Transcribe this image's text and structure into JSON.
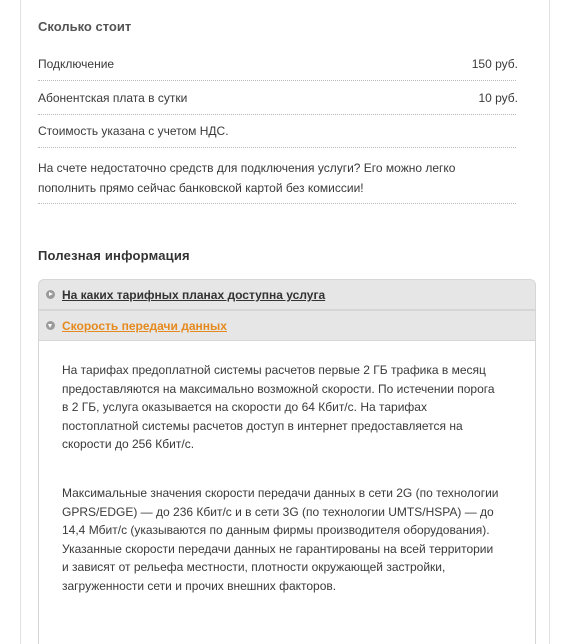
{
  "cost": {
    "title": "Сколько стоит",
    "rows": [
      {
        "label": "Подключение",
        "price": "150 руб."
      },
      {
        "label": "Абонентская плата в сутки",
        "price": "10 руб."
      }
    ],
    "vat_note": "Стоимость указана с учетом НДС.",
    "topup_note": "На счете недостаточно средств для подключения услуги? Его можно легко пополнить прямо сейчас банковской картой без комиссии!"
  },
  "useful": {
    "title": "Полезная информация",
    "items": [
      {
        "label": "На каких тарифных планах доступна услуга"
      },
      {
        "label": "Скорость передачи данных"
      }
    ],
    "body_paragraphs": [
      "На тарифах предоплатной системы расчетов первые 2 ГБ трафика в месяц предоставляются на максимально возможной скорости. По истечении порога в 2 ГБ, услуга оказывается на скорости до 64 Кбит/с. На тарифах постоплатной системы расчетов доступ в интернет предоставляется на скорости до 256 Кбит/с.",
      "Максимальные значения скорости передачи данных в сети 2G (по технологии GPRS/EDGE) — до 236 Кбит/с и в сети 3G (по технологии UMTS/HSPA) — до 14,4 Мбит/с (указываются по данным фирмы производителя оборудования). Указанные скорости передачи данных не гарантированы на всей территории и зависят от рельефа местности, плотности окружающей застройки, загруженности сети и прочих внешних факторов."
    ]
  },
  "colors": {
    "accent": "#e58a1f",
    "header_bg": "#e6e6e6"
  }
}
